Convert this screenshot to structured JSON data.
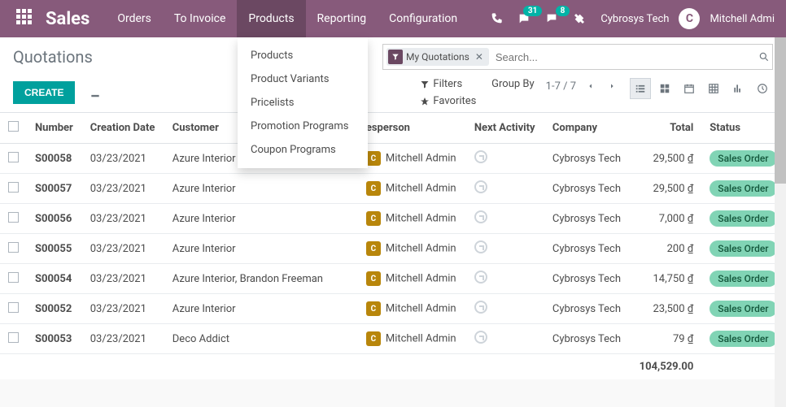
{
  "brand": "Sales",
  "nav": [
    "Orders",
    "To Invoice",
    "Products",
    "Reporting",
    "Configuration"
  ],
  "active_nav": "Products",
  "dropdown": [
    "Products",
    "Product Variants",
    "Pricelists",
    "Promotion Programs",
    "Coupon Programs"
  ],
  "topbar": {
    "messages_badge": "31",
    "chat_badge": "8",
    "company": "Cybrosys Tech",
    "user": "Mitchell Admi",
    "avatar_letter": "C"
  },
  "breadcrumb": "Quotations",
  "create_label": "CREATE",
  "search": {
    "chip_label": "My Quotations",
    "placeholder": "Search..."
  },
  "tools": {
    "filters": "Filters",
    "groupby": "Group By",
    "favorites": "Favorites",
    "pager": "1-7 / 7"
  },
  "columns": {
    "number": "Number",
    "creation": "Creation Date",
    "customer": "Customer",
    "salesperson": "esperson",
    "activity": "Next Activity",
    "company": "Company",
    "total": "Total",
    "status": "Status"
  },
  "rows": [
    {
      "num": "S00058",
      "date": "03/23/2021",
      "cust": "Azure Interior",
      "sp": "Mitchell Admin",
      "co": "Cybrosys Tech",
      "total": "29,500 ₫",
      "status": "Sales Order"
    },
    {
      "num": "S00057",
      "date": "03/23/2021",
      "cust": "Azure Interior",
      "sp": "Mitchell Admin",
      "co": "Cybrosys Tech",
      "total": "29,500 ₫",
      "status": "Sales Order"
    },
    {
      "num": "S00056",
      "date": "03/23/2021",
      "cust": "Azure Interior",
      "sp": "Mitchell Admin",
      "co": "Cybrosys Tech",
      "total": "7,000 ₫",
      "status": "Sales Order"
    },
    {
      "num": "S00055",
      "date": "03/23/2021",
      "cust": "Azure Interior",
      "sp": "Mitchell Admin",
      "co": "Cybrosys Tech",
      "total": "200 ₫",
      "status": "Sales Order"
    },
    {
      "num": "S00054",
      "date": "03/23/2021",
      "cust": "Azure Interior, Brandon Freeman",
      "sp": "Mitchell Admin",
      "co": "Cybrosys Tech",
      "total": "14,750 ₫",
      "status": "Sales Order"
    },
    {
      "num": "S00052",
      "date": "03/23/2021",
      "cust": "Azure Interior",
      "sp": "Mitchell Admin",
      "co": "Cybrosys Tech",
      "total": "23,500 ₫",
      "status": "Sales Order"
    },
    {
      "num": "S00053",
      "date": "03/23/2021",
      "cust": "Deco Addict",
      "sp": "Mitchell Admin",
      "co": "Cybrosys Tech",
      "total": "79 ₫",
      "status": "Sales Order"
    }
  ],
  "grand_total": "104,529.00"
}
